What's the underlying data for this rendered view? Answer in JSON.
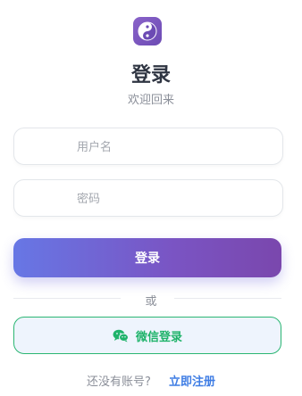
{
  "app": {
    "title": "登录",
    "subtitle": "欢迎回来",
    "logo_icon": "yin-yang-icon",
    "accent": "#6f64d6"
  },
  "form": {
    "username_placeholder": "用户名",
    "password_placeholder": "密码",
    "login_label": "登录"
  },
  "divider": {
    "label": "或"
  },
  "wechat": {
    "label": "微信登录",
    "icon": "wechat-icon",
    "color": "#1fb36a"
  },
  "register": {
    "prompt": "还没有账号?",
    "link_label": "立即注册",
    "link_color": "#3f7de4"
  }
}
